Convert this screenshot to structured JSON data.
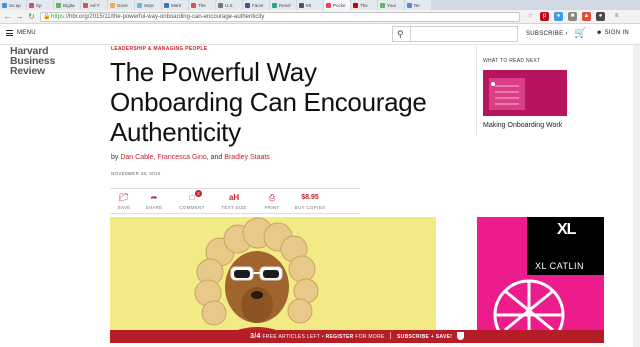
{
  "browser": {
    "tabs": [
      {
        "label": "So ap",
        "color": "#4a90d9"
      },
      {
        "label": "Sp",
        "color": "#d9534f"
      },
      {
        "label": "Digita",
        "color": "#5cb85c"
      },
      {
        "label": "Ad Y",
        "color": "#d9534f"
      },
      {
        "label": "Gove",
        "color": "#f0ad4e"
      },
      {
        "label": "Sepc",
        "color": "#5bc0de"
      },
      {
        "label": "Marit",
        "color": "#337ab7"
      },
      {
        "label": "The",
        "color": "#d9534f"
      },
      {
        "label": "U.S.",
        "color": "#777777"
      },
      {
        "label": "Facet",
        "color": "#3b5998"
      },
      {
        "label": "Resol",
        "color": "#2ca58d"
      },
      {
        "label": "Mt",
        "color": "#555555"
      },
      {
        "label": "Pocke",
        "color": "#ef4056"
      },
      {
        "label": "The",
        "color": "#cc0000"
      },
      {
        "label": "Your",
        "color": "#5cb85c"
      },
      {
        "label": "Re",
        "color": "#4a90d9"
      }
    ],
    "url_scheme": "https",
    "url_rest": "://hbr.org/2015/11/the-powerful-way-onboarding-can-encourage-authenticity"
  },
  "header": {
    "menu_label": "MENU",
    "subscribe_label": "SUBSCRIBE",
    "signin_label": "SIGN IN"
  },
  "logo": {
    "line1": "Harvard",
    "line2": "Business",
    "line3": "Review"
  },
  "article": {
    "category": "LEADERSHIP & MANAGING PEOPLE",
    "title": "The Powerful Way Onboarding Can Encourage Authenticity",
    "by": "by",
    "authors": [
      "Dan Cable",
      "Francesca Gino",
      "Bradley Staats"
    ],
    "and": "and",
    "date": "NOVEMBER 26, 2015",
    "tools": [
      {
        "label": "SAVE"
      },
      {
        "label": "SHARE"
      },
      {
        "label": "COMMENT",
        "badge": "2"
      },
      {
        "label": "TEXT SIZE"
      },
      {
        "label": "PRINT"
      },
      {
        "label": "BUY COPIES",
        "price": "$8.95"
      }
    ]
  },
  "sidebar": {
    "heading": "WHAT TO READ NEXT",
    "item_title": "Making Onboarding Work"
  },
  "ad": {
    "logo_text": "XL",
    "brand": "XL CATLIN"
  },
  "promo": {
    "count": "3/4",
    "articles_left": "FREE ARTICLES LEFT",
    "register": "REGISTER",
    "for_more": "FOR MORE",
    "subscribe": "SUBSCRIBE + SAVE!"
  },
  "colors": {
    "accent": "#c8202f",
    "promo_bg": "#b51d27",
    "hero_bg": "#f2ea84",
    "ad_pink": "#ec1c8d"
  }
}
